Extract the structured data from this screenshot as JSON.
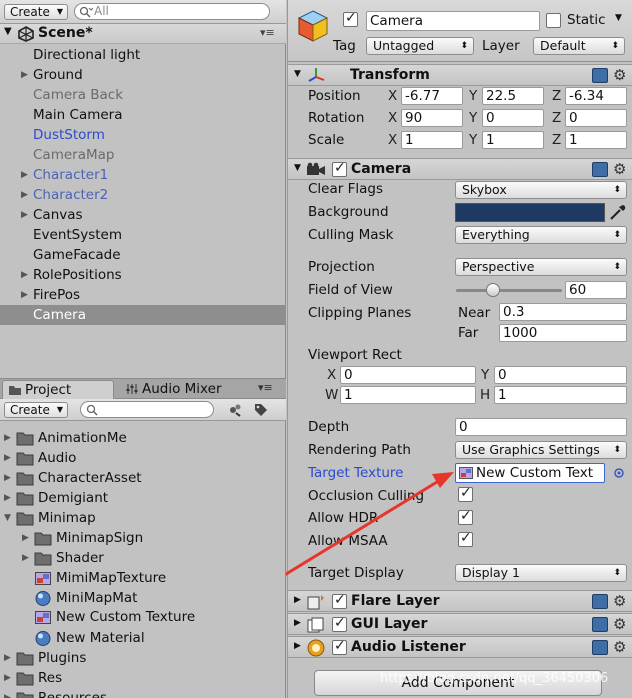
{
  "hierarchy": {
    "create_label": "Create",
    "search_placeholder": "All",
    "scene_name": "Scene*",
    "items": [
      {
        "label": "Directional light",
        "arrow": false,
        "color": "#111111"
      },
      {
        "label": "Ground",
        "arrow": true,
        "color": "#111111"
      },
      {
        "label": "Camera Back",
        "arrow": false,
        "color": "#6a6a6a"
      },
      {
        "label": "Main Camera",
        "arrow": false,
        "color": "#111111"
      },
      {
        "label": "DustStorm",
        "arrow": false,
        "color": "#2b4bcf"
      },
      {
        "label": "CameraMap",
        "arrow": false,
        "color": "#6a6a6a"
      },
      {
        "label": "Character1",
        "arrow": true,
        "color": "#4c63b5"
      },
      {
        "label": "Character2",
        "arrow": true,
        "color": "#4c63b5"
      },
      {
        "label": "Canvas",
        "arrow": true,
        "color": "#111111"
      },
      {
        "label": "EventSystem",
        "arrow": false,
        "color": "#111111"
      },
      {
        "label": "GameFacade",
        "arrow": false,
        "color": "#111111"
      },
      {
        "label": "RolePositions",
        "arrow": true,
        "color": "#111111"
      },
      {
        "label": "FirePos",
        "arrow": true,
        "color": "#111111"
      },
      {
        "label": "Camera",
        "arrow": false,
        "color": "#ffffff",
        "selected": true
      }
    ]
  },
  "project": {
    "tab_project": "Project",
    "tab_audio_mixer": "Audio Mixer",
    "create_label": "Create",
    "items": [
      {
        "label": "AnimationMe",
        "type": "folder",
        "indent": 0,
        "arrow": true
      },
      {
        "label": "Audio",
        "type": "folder",
        "indent": 0,
        "arrow": true
      },
      {
        "label": "CharacterAsset",
        "type": "folder",
        "indent": 0,
        "arrow": true
      },
      {
        "label": "Demigiant",
        "type": "folder",
        "indent": 0,
        "arrow": true
      },
      {
        "label": "Minimap",
        "type": "folder",
        "indent": 0,
        "arrow": "open"
      },
      {
        "label": "MinimapSign",
        "type": "folder",
        "indent": 1,
        "arrow": true
      },
      {
        "label": "Shader",
        "type": "folder",
        "indent": 1,
        "arrow": true
      },
      {
        "label": "MimiMapTexture",
        "type": "texture",
        "indent": 1,
        "arrow": false
      },
      {
        "label": "MiniMapMat",
        "type": "material",
        "indent": 1,
        "arrow": false
      },
      {
        "label": "New Custom Texture",
        "type": "texture",
        "indent": 1,
        "arrow": false,
        "highlight": true
      },
      {
        "label": "New Material",
        "type": "material",
        "indent": 1,
        "arrow": false
      },
      {
        "label": "Plugins",
        "type": "folder",
        "indent": 0,
        "arrow": true
      },
      {
        "label": "Res",
        "type": "folder",
        "indent": 0,
        "arrow": true
      },
      {
        "label": "Resources",
        "type": "folder",
        "indent": 0,
        "arrow": true
      }
    ]
  },
  "inspector": {
    "object_name": "Camera",
    "static_label": "Static",
    "tag_label": "Tag",
    "tag_value": "Untagged",
    "layer_label": "Layer",
    "layer_value": "Default",
    "transform": {
      "title": "Transform",
      "position_label": "Position",
      "position": {
        "x": "-6.77",
        "y": "22.5",
        "z": "-6.34"
      },
      "rotation_label": "Rotation",
      "rotation": {
        "x": "90",
        "y": "0",
        "z": "0"
      },
      "scale_label": "Scale",
      "scale": {
        "x": "1",
        "y": "1",
        "z": "1"
      }
    },
    "camera": {
      "title": "Camera",
      "clear_flags_label": "Clear Flags",
      "clear_flags": "Skybox",
      "background_label": "Background",
      "background_color": "#1f3a62",
      "culling_mask_label": "Culling Mask",
      "culling_mask": "Everything",
      "projection_label": "Projection",
      "projection": "Perspective",
      "fov_label": "Field of View",
      "fov": "60",
      "fov_fraction": 0.35,
      "clipping_label": "Clipping Planes",
      "near_label": "Near",
      "near": "0.3",
      "far_label": "Far",
      "far": "1000",
      "viewport_label": "Viewport Rect",
      "viewport": {
        "x_label": "X",
        "x": "0",
        "y_label": "Y",
        "y": "0",
        "w_label": "W",
        "w": "1",
        "h_label": "H",
        "h": "1"
      },
      "depth_label": "Depth",
      "depth": "0",
      "rendering_path_label": "Rendering Path",
      "rendering_path": "Use Graphics Settings",
      "target_texture_label": "Target Texture",
      "target_texture": "New Custom Text",
      "occlusion_label": "Occlusion Culling",
      "hdr_label": "Allow HDR",
      "msaa_label": "Allow MSAA",
      "target_display_label": "Target Display",
      "target_display": "Display 1"
    },
    "flare_layer": "Flare Layer",
    "gui_layer": "GUI Layer",
    "audio_listener": "Audio Listener",
    "add_component": "Add Component",
    "watermark": "https://blog.csdn.net/qq_36450306"
  },
  "colors": {
    "arrow": "#e8352b",
    "highlight": "#f6ee26"
  }
}
